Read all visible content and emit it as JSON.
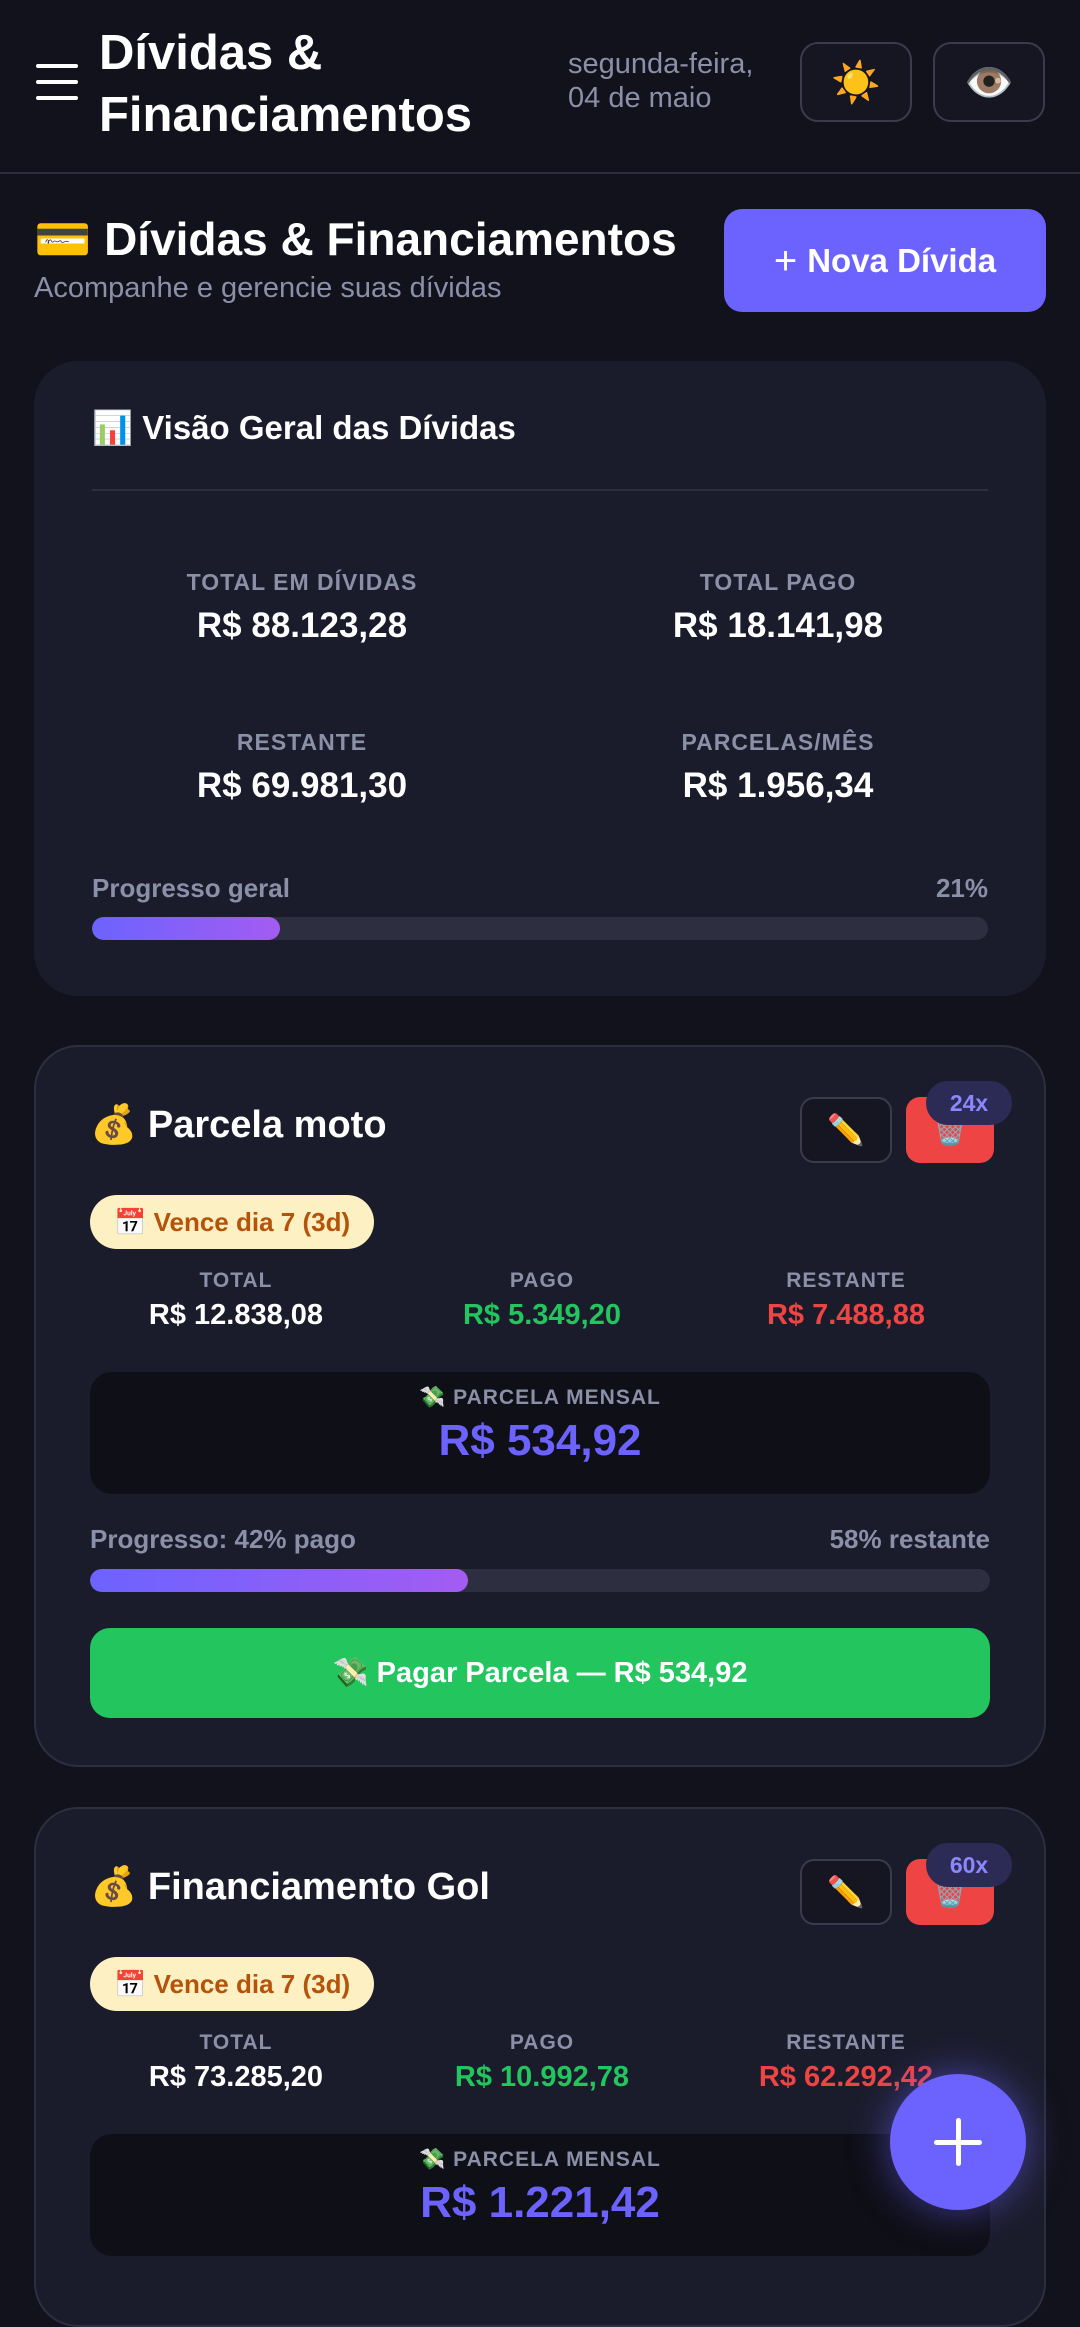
{
  "header": {
    "title": "Dívidas & Financiamentos",
    "date": "segunda-feira, 04 de maio",
    "theme_icon": "sun-icon",
    "visibility_icon": "eye-icon"
  },
  "page": {
    "emoji": "💳",
    "title": "Dívidas & Financiamentos",
    "subtitle": "Acompanhe e gerencie suas dívidas",
    "new_button": "Nova Dívida"
  },
  "overview": {
    "emoji": "📊",
    "title": "Visão Geral das Dívidas",
    "stats": [
      {
        "label": "Total em Dívidas",
        "value": "R$ 88.123,28"
      },
      {
        "label": "Total Pago",
        "value": "R$ 18.141,98"
      },
      {
        "label": "Restante",
        "value": "R$ 69.981,30"
      },
      {
        "label": "Parcelas/Mês",
        "value": "R$ 1.956,34"
      }
    ],
    "progress_label": "Progresso geral",
    "progress_text": "21%",
    "progress_fraction": 0.21
  },
  "debts": [
    {
      "emoji": "💰",
      "name": "Parcela moto",
      "installments_badge": "24x",
      "due": "📅 Vence dia 7 (3d)",
      "total_label": "Total",
      "total": "R$ 12.838,08",
      "paid_label": "Pago",
      "paid": "R$ 5.349,20",
      "remaining_label": "Restante",
      "remaining": "R$ 7.488,88",
      "monthly_label": "💸 Parcela mensal",
      "monthly": "R$ 534,92",
      "progress_left": "Progresso: 42% pago",
      "progress_right": "58% restante",
      "progress_fraction": 0.42,
      "pay_button": "💸 Pagar Parcela — R$ 534,92"
    },
    {
      "emoji": "💰",
      "name": "Financiamento Gol",
      "installments_badge": "60x",
      "due": "📅 Vence dia 7 (3d)",
      "total_label": "Total",
      "total": "R$ 73.285,20",
      "paid_label": "Pago",
      "paid": "R$ 10.992,78",
      "remaining_label": "Restante",
      "remaining": "R$ 62.292,42",
      "monthly_label": "💸 Parcela mensal",
      "monthly": "R$ 1.221,42"
    }
  ],
  "icons": {
    "edit": "pencil-icon",
    "delete": "trash-icon",
    "fab": "plus-icon"
  },
  "colors": {
    "accent": "#6c63ff",
    "paid": "#22c55e",
    "remaining": "#ef4444",
    "due_badge_bg": "#fdf0c3",
    "due_badge_text": "#b45309"
  }
}
